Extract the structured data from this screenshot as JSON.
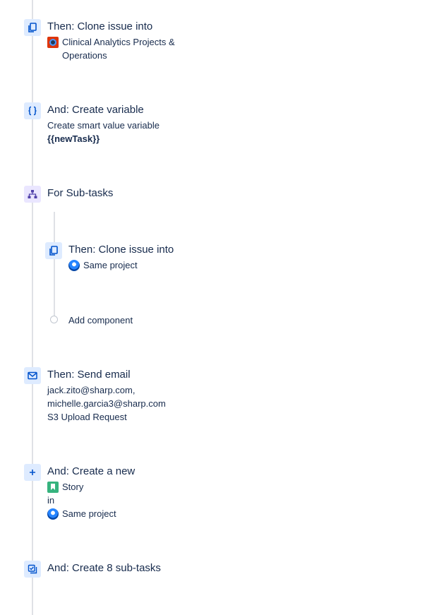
{
  "steps": [
    {
      "title": "Then: Clone issue into",
      "icon": "clone-icon",
      "project_name": "Clinical Analytics Projects &",
      "project_name_line2": "Operations",
      "project_icon": "project-avatar-icon"
    },
    {
      "title": "And: Create variable",
      "icon": "braces-icon",
      "line1": "Create smart value variable",
      "line2": "{{newTask}}"
    },
    {
      "title": "For Sub-tasks",
      "icon": "branch-icon"
    },
    {
      "title": "Then: Clone issue into",
      "icon": "clone-icon",
      "project_name": "Same project",
      "project_icon": "same-project-icon"
    },
    {
      "title": "Then: Send email",
      "icon": "mail-icon",
      "line1": "jack.zito@sharp.com,",
      "line2": "michelle.garcia3@sharp.com",
      "line3": "S3 Upload Request"
    },
    {
      "title": "And: Create a new",
      "icon": "plus-icon",
      "issue_type": "Story",
      "connector": "in",
      "project_name": "Same project"
    },
    {
      "title": "And: Create 8 sub-tasks",
      "icon": "subtasks-icon"
    }
  ],
  "add_component_label": "Add component",
  "colors": {
    "icon_bg_blue": "#deebff",
    "icon_fg_blue": "#0052cc",
    "icon_bg_purple": "#eae6ff",
    "icon_fg_purple": "#5243aa",
    "rail": "#dfe1e6",
    "story_green": "#36b37e",
    "text": "#172b4d"
  }
}
